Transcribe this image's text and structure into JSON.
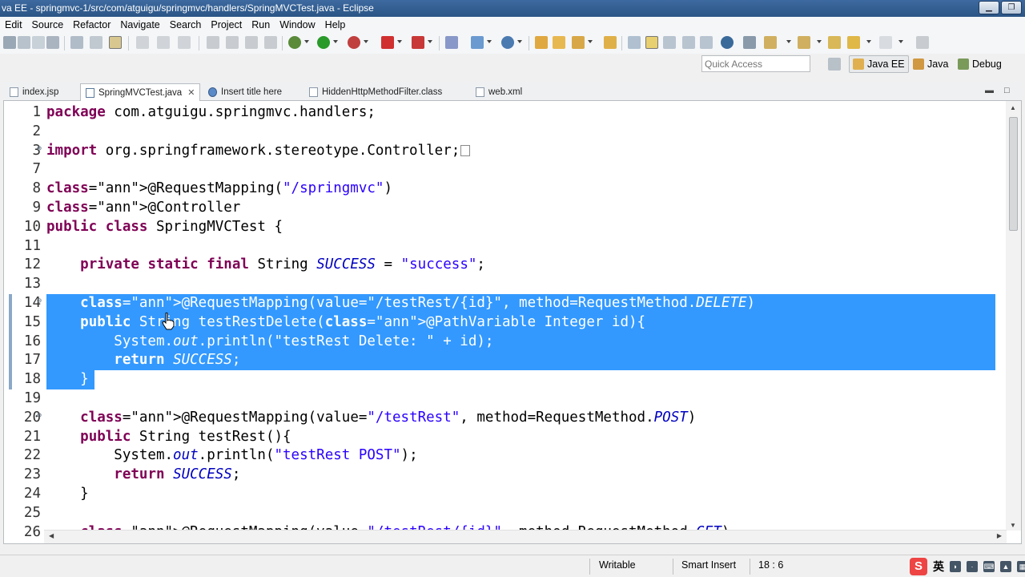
{
  "window": {
    "title": "va EE - springmvc-1/src/com/atguigu/springmvc/handlers/SpringMVCTest.java - Eclipse",
    "minimize_glyph": "▁",
    "maximize_glyph": "❐",
    "close_glyph": "✕"
  },
  "menu": [
    "Edit",
    "Source",
    "Refactor",
    "Navigate",
    "Search",
    "Project",
    "Run",
    "Window",
    "Help"
  ],
  "toolbar": {
    "quick_access_placeholder": "Quick Access",
    "perspectives": [
      {
        "label": "Java EE",
        "icon": "java-ee-perspective-icon",
        "active": true
      },
      {
        "label": "Java",
        "icon": "java-perspective-icon",
        "active": false
      },
      {
        "label": "Debug",
        "icon": "debug-perspective-icon",
        "active": false
      }
    ]
  },
  "tabs": [
    {
      "label": "index.jsp",
      "icon": "jsp-file-icon",
      "active": false
    },
    {
      "label": "SpringMVCTest.java",
      "icon": "java-file-icon",
      "active": true,
      "close": "✕"
    },
    {
      "label": "Insert title here",
      "icon": "browser-globe-icon",
      "active": false
    },
    {
      "label": "HiddenHttpMethodFilter.class",
      "icon": "class-file-icon",
      "active": false
    },
    {
      "label": "web.xml",
      "icon": "xml-file-icon",
      "active": false
    }
  ],
  "editor": {
    "lines": [
      {
        "n": "1",
        "text": "package com.atguigu.springmvc.handlers;"
      },
      {
        "n": "2",
        "text": ""
      },
      {
        "n": "3",
        "text": "import org.springframework.stereotype.Controller;"
      },
      {
        "n": "7",
        "text": ""
      },
      {
        "n": "8",
        "text": "@RequestMapping(\"/springmvc\")"
      },
      {
        "n": "9",
        "text": "@Controller"
      },
      {
        "n": "10",
        "text": "public class SpringMVCTest {"
      },
      {
        "n": "11",
        "text": ""
      },
      {
        "n": "12",
        "text": "    private static final String SUCCESS = \"success\";"
      },
      {
        "n": "13",
        "text": ""
      },
      {
        "n": "14",
        "text": "    @RequestMapping(value=\"/testRest/{id}\", method=RequestMethod.DELETE)"
      },
      {
        "n": "15",
        "text": "    public String testRestDelete(@PathVariable Integer id){"
      },
      {
        "n": "16",
        "text": "        System.out.println(\"testRest Delete: \" + id);"
      },
      {
        "n": "17",
        "text": "        return SUCCESS;"
      },
      {
        "n": "18",
        "text": "    }"
      },
      {
        "n": "19",
        "text": ""
      },
      {
        "n": "20",
        "text": "    @RequestMapping(value=\"/testRest\", method=RequestMethod.POST)"
      },
      {
        "n": "21",
        "text": "    public String testRest(){"
      },
      {
        "n": "22",
        "text": "        System.out.println(\"testRest POST\");"
      },
      {
        "n": "23",
        "text": "        return SUCCESS;"
      },
      {
        "n": "24",
        "text": "    }"
      },
      {
        "n": "25",
        "text": ""
      },
      {
        "n": "26",
        "text": "    @RequestMapping(value=\"/testRest/{id}\", method=RequestMethod.GET)"
      }
    ],
    "selected_lines": [
      "14",
      "15",
      "16",
      "17",
      "18"
    ],
    "folded_lines": [
      "3",
      "14",
      "20"
    ]
  },
  "status": {
    "writable": "Writable",
    "insert_mode": "Smart Insert",
    "position": "18 : 6",
    "ime_logo": "S",
    "ime_lang": "英"
  },
  "colors": {
    "keyword": "#7f0055",
    "string": "#2a00ff",
    "static_field": "#0000c0",
    "selection": "#3399ff",
    "titlebar": "#2f5c8f"
  }
}
